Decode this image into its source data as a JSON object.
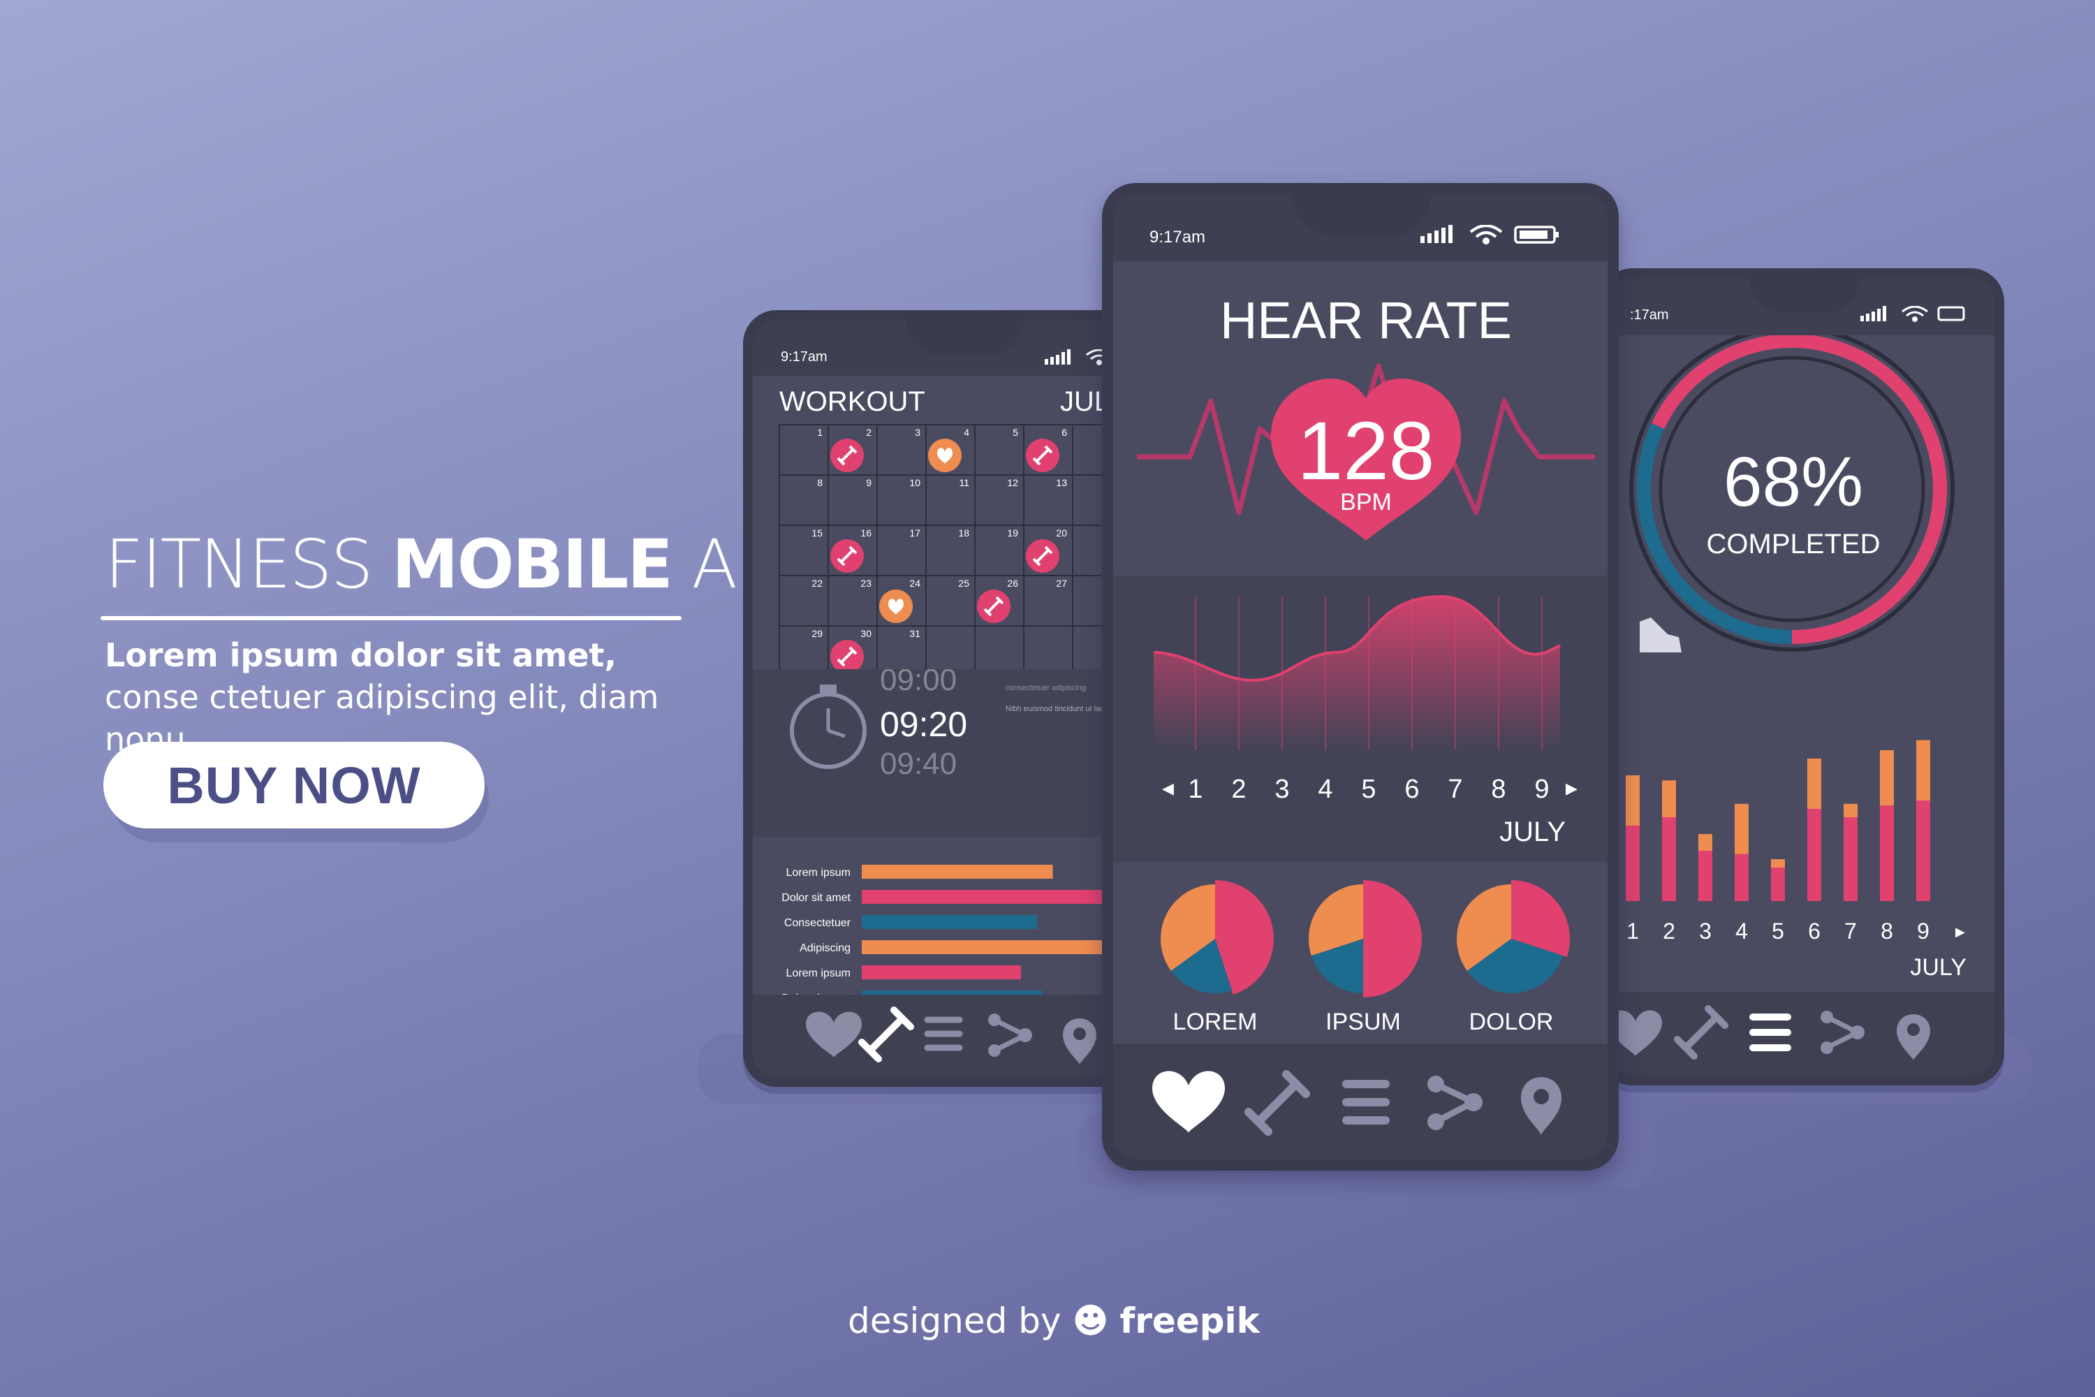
{
  "hero": {
    "title_light_1": "FITNESS ",
    "title_bold": "MOBILE",
    "title_light_2": " APP",
    "subtitle_bold": "Lorem ipsum dolor sit amet,",
    "subtitle_rest": " conse ctetuer adipiscing elit, diam nonu.",
    "buy_label": "BUY NOW"
  },
  "status": {
    "time": "9:17am",
    "time_cut": ":17am"
  },
  "left_phone": {
    "title": "WORKOUT",
    "month": "JULY",
    "calendar_days": [
      "1",
      "2",
      "3",
      "4",
      "5",
      "6",
      "8",
      "9",
      "10",
      "11",
      "12",
      "13",
      "15",
      "16",
      "17",
      "18",
      "19",
      "20",
      "22",
      "23",
      "24",
      "25",
      "26",
      "27",
      "29",
      "30",
      "31"
    ],
    "timer": {
      "prev": "09:00",
      "current": "09:20",
      "next": "09:40",
      "note1": "consectetuer adipiscing",
      "note2": "Nibh euismod tincidunt ut laoreet dolore magna"
    },
    "bars": [
      {
        "label": "Lorem ipsum",
        "value": 0.72,
        "color": "#ef8c50"
      },
      {
        "label": "Dolor sit amet",
        "value": 0.95,
        "color": "#e0416f"
      },
      {
        "label": "Consectetuer",
        "value": 0.66,
        "color": "#1d6b8f"
      },
      {
        "label": "Adipiscing",
        "value": 0.92,
        "color": "#ef8c50"
      },
      {
        "label": "Lorem ipsum",
        "value": 0.6,
        "color": "#e0416f"
      },
      {
        "label": "Dolor sit amet",
        "value": 0.68,
        "color": "#1d6b8f"
      }
    ]
  },
  "center_phone": {
    "title": "HEAR RATE",
    "bpm": "128",
    "bpm_unit": "BPM",
    "days": [
      "1",
      "2",
      "3",
      "4",
      "5",
      "6",
      "7",
      "8",
      "9"
    ],
    "month": "JULY",
    "pies": [
      {
        "label": "LOREM",
        "slices": [
          0.45,
          0.2,
          0.35
        ]
      },
      {
        "label": "IPSUM",
        "slices": [
          0.5,
          0.2,
          0.3
        ]
      },
      {
        "label": "DOLOR",
        "slices": [
          0.3,
          0.35,
          0.35
        ]
      }
    ],
    "pie_colors": [
      "#e0416f",
      "#1d6b8f",
      "#ef8c50"
    ]
  },
  "right_phone": {
    "percent": "68%",
    "status": "COMPLETED",
    "progress": 0.68,
    "month": "JULY",
    "days": [
      "1",
      "2",
      "3",
      "4",
      "5",
      "6",
      "7",
      "8",
      "9"
    ],
    "bars": [
      {
        "bottom": 0.45,
        "top": 0.3
      },
      {
        "bottom": 0.5,
        "top": 0.22
      },
      {
        "bottom": 0.3,
        "top": 0.1
      },
      {
        "bottom": 0.28,
        "top": 0.3
      },
      {
        "bottom": 0.2,
        "top": 0.05
      },
      {
        "bottom": 0.55,
        "top": 0.3
      },
      {
        "bottom": 0.5,
        "top": 0.08
      },
      {
        "bottom": 0.57,
        "top": 0.33
      },
      {
        "bottom": 0.6,
        "top": 0.36
      }
    ]
  },
  "credit": {
    "prefix": "designed by ",
    "brand": "freepik"
  },
  "colors": {
    "pink": "#e0416f",
    "orange": "#ef8c50",
    "blue": "#1d6b8f",
    "panel": "#4a4b60",
    "panel_dark": "#3f4052"
  }
}
